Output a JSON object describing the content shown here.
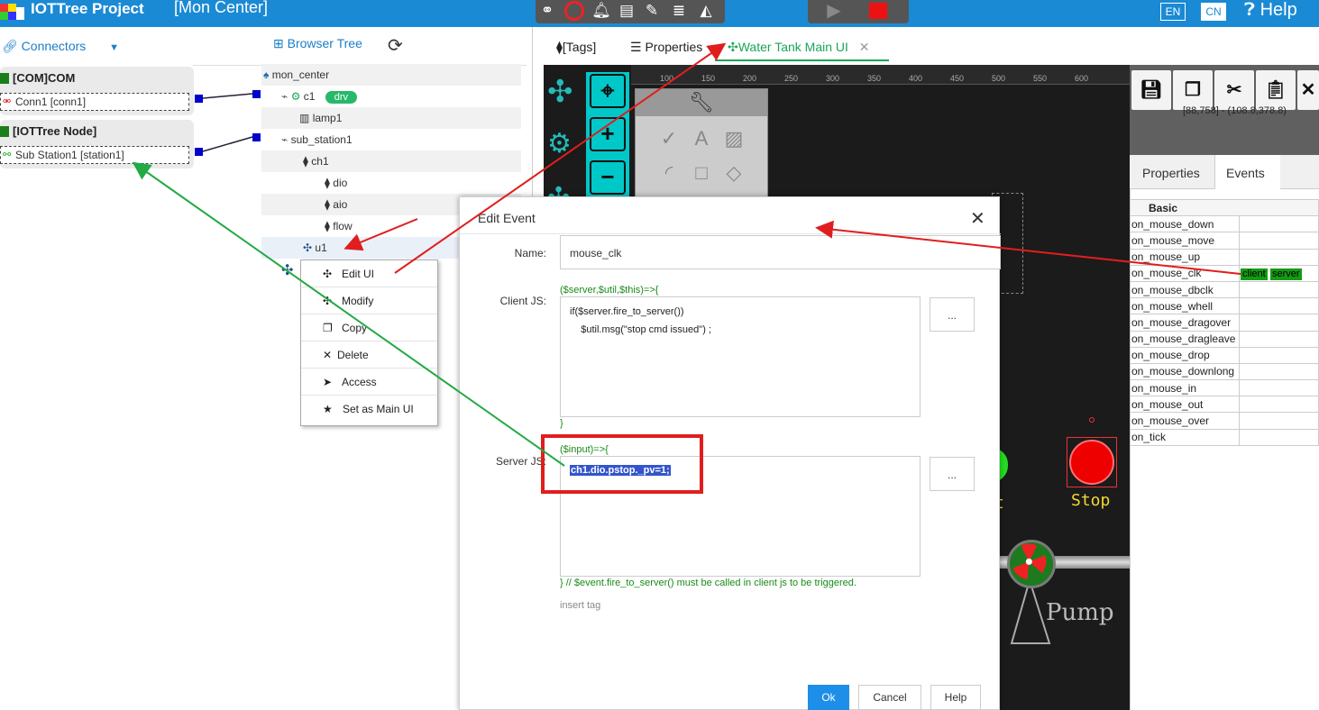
{
  "app": {
    "title": "IOTTree Project",
    "page": "[Mon Center]",
    "help": "Help",
    "lang_en": "EN",
    "lang_cn": "CN"
  },
  "toolbar": {
    "icons": [
      "share-icon",
      "record-icon",
      "bell-icon",
      "doc-icon",
      "edit-icon",
      "database-icon",
      "chart-icon"
    ],
    "play": "play-icon",
    "stop": "stop-icon"
  },
  "left": {
    "connectors_label": "Connectors",
    "nodes": [
      {
        "title": "[COM]COM",
        "child": "Conn1 [conn1]"
      },
      {
        "title": "[IOTTree Node]",
        "child": "Sub Station1 [station1]"
      }
    ]
  },
  "tree": {
    "header": "Browser Tree",
    "root": "mon_center",
    "c1": "c1",
    "drv_badge": "drv",
    "lamp1": "lamp1",
    "sub_station1": "sub_station1",
    "ch1": "ch1",
    "dio": "dio",
    "aio": "aio",
    "flow": "flow",
    "u1": "u1"
  },
  "context_menu": {
    "items": [
      {
        "label": "Edit UI"
      },
      {
        "label": "Modify"
      },
      {
        "label": "Copy"
      },
      {
        "label": "Delete"
      },
      {
        "label": "Access"
      },
      {
        "label": "Set as Main UI"
      }
    ]
  },
  "tabs": {
    "tags": "[Tags]",
    "properties": "Properties",
    "water": "Water Tank Main UI"
  },
  "ruler": [
    "100",
    "150",
    "200",
    "250",
    "300",
    "350",
    "400",
    "450",
    "500",
    "550",
    "600"
  ],
  "right": {
    "coords": "[88,758] - (108.8,378.8)",
    "tab_properties": "Properties",
    "tab_events": "Events",
    "section": "Basic",
    "events": [
      "on_mouse_down",
      "on_mouse_move",
      "on_mouse_up",
      "on_mouse_clk",
      "on_mouse_dbclk",
      "on_mouse_whell",
      "on_mouse_dragover",
      "on_mouse_dragleave",
      "on_mouse_drop",
      "on_mouse_downlong",
      "on_mouse_in",
      "on_mouse_out",
      "on_mouse_over",
      "on_tick"
    ],
    "clk_client": "client",
    "clk_server": "server"
  },
  "scene": {
    "stop": "Stop",
    "t_char": "t",
    "pump": "Pump"
  },
  "dialog": {
    "title": "Edit Event",
    "name_label": "Name:",
    "name_value": "mouse_clk",
    "client_label": "Client JS:",
    "client_head": "($server,$util,$this)=>{",
    "client_line1": "if($server.fire_to_server())",
    "client_line2": "    $util.msg(\"stop cmd issued\") ;",
    "client_tail": "}",
    "server_label": "Server JS:",
    "server_head": "($input)=>{",
    "server_code": "ch1.dio.pstop._pv=1;",
    "server_tail": "} // $event.fire_to_server() must be called in client js to be triggered.",
    "insert_tag": "insert tag",
    "dots": "...",
    "ok": "Ok",
    "cancel": "Cancel",
    "help": "Help"
  },
  "colors": {
    "topbar": "#1b8ad4",
    "accent_green": "#1aa55a",
    "annotation_red": "#e01e1e",
    "annotation_green": "#22aa44"
  }
}
